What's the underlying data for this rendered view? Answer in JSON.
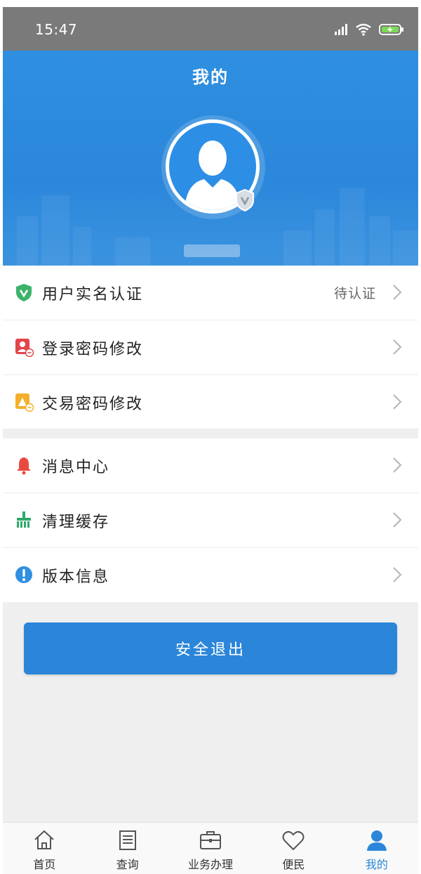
{
  "status_bar": {
    "time": "15:47"
  },
  "header": {
    "title": "我的"
  },
  "menu_group_1": [
    {
      "label": "用户实名认证",
      "value": "待认证",
      "icon": "shield-v-icon"
    },
    {
      "label": "登录密码修改",
      "value": "",
      "icon": "user-key-icon"
    },
    {
      "label": "交易密码修改",
      "value": "",
      "icon": "lock-key-icon"
    }
  ],
  "menu_group_2": [
    {
      "label": "消息中心",
      "icon": "bell-icon"
    },
    {
      "label": "清理缓存",
      "icon": "broom-icon"
    },
    {
      "label": "版本信息",
      "icon": "info-icon"
    }
  ],
  "logout_label": "安全退出",
  "tabs": [
    {
      "label": "首页",
      "icon": "home-icon",
      "active": false
    },
    {
      "label": "查询",
      "icon": "document-icon",
      "active": false
    },
    {
      "label": "业务办理",
      "icon": "briefcase-icon",
      "active": false
    },
    {
      "label": "便民",
      "icon": "heart-icon",
      "active": false
    },
    {
      "label": "我的",
      "icon": "person-icon",
      "active": true
    }
  ],
  "colors": {
    "primary": "#2b86d9",
    "status_bar": "#7a7a7a",
    "shield_green": "#3bb36b",
    "bell_red": "#e94a3f",
    "broom_green": "#2eaa6a",
    "info_blue": "#2f8fe0"
  }
}
